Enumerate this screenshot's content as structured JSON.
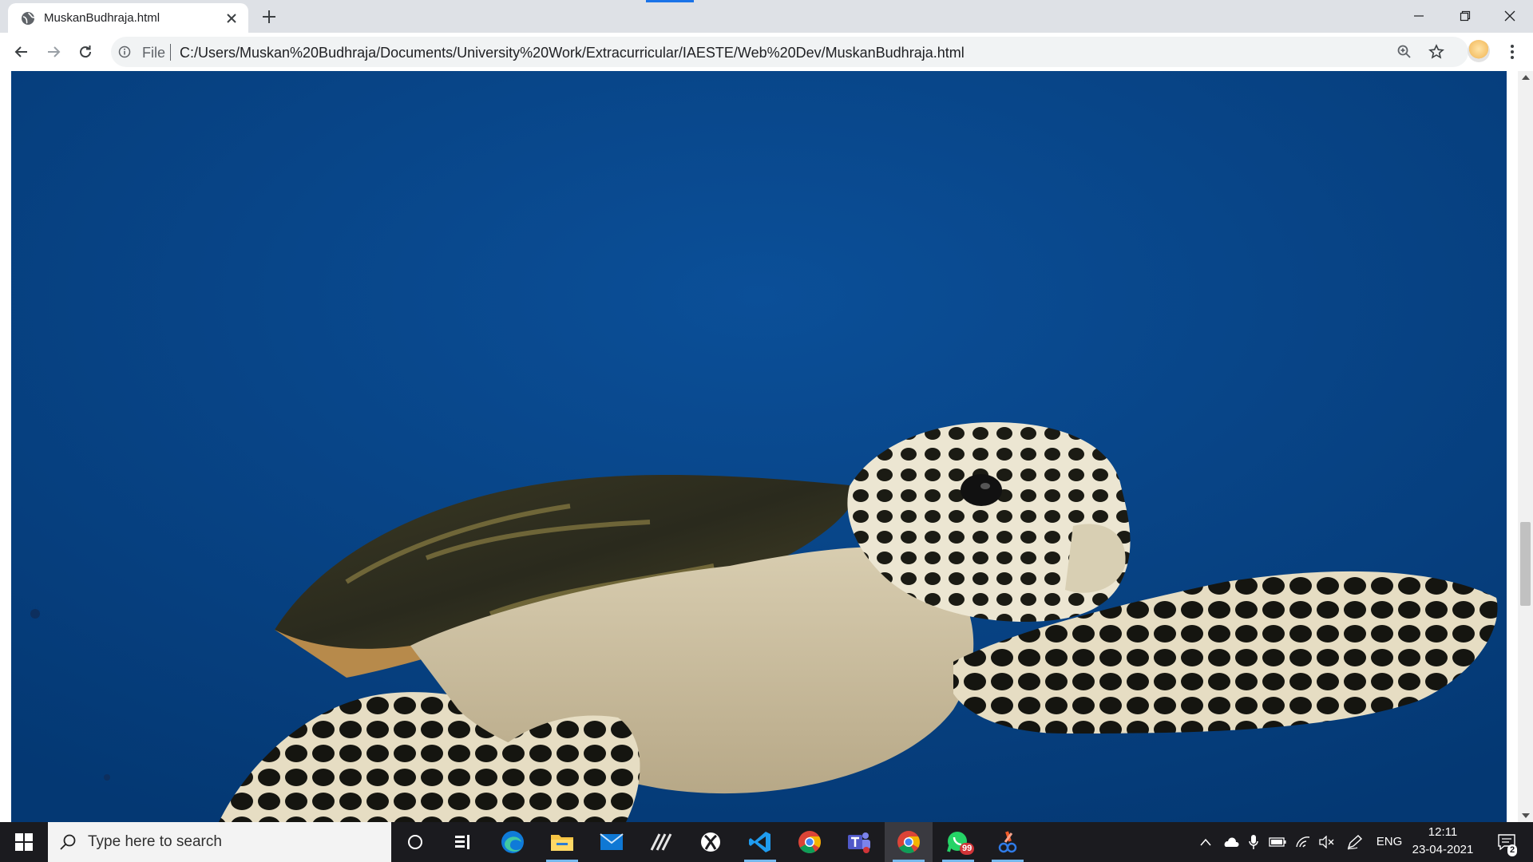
{
  "browser": {
    "tab_title": "MuskanBudhraja.html",
    "scheme_label": "File",
    "url": "C:/Users/Muskan%20Budhraja/Documents/University%20Work/Extracurricular/IAESTE/Web%20Dev/MuskanBudhraja.html"
  },
  "page": {
    "image_subject": "hawksbill sea turtle swimming in deep blue water",
    "scroll_position": 0.62
  },
  "taskbar": {
    "search_placeholder": "Type here to search",
    "apps": [
      "cortana",
      "task-view",
      "edge",
      "file-explorer",
      "mail",
      "app-slash",
      "xbox",
      "vscode",
      "chrome",
      "teams",
      "chrome",
      "whatsapp",
      "snip-sketch"
    ],
    "whatsapp_badge": "99",
    "language": "ENG",
    "time": "12:11",
    "date": "23-04-2021",
    "notification_count": "2"
  }
}
